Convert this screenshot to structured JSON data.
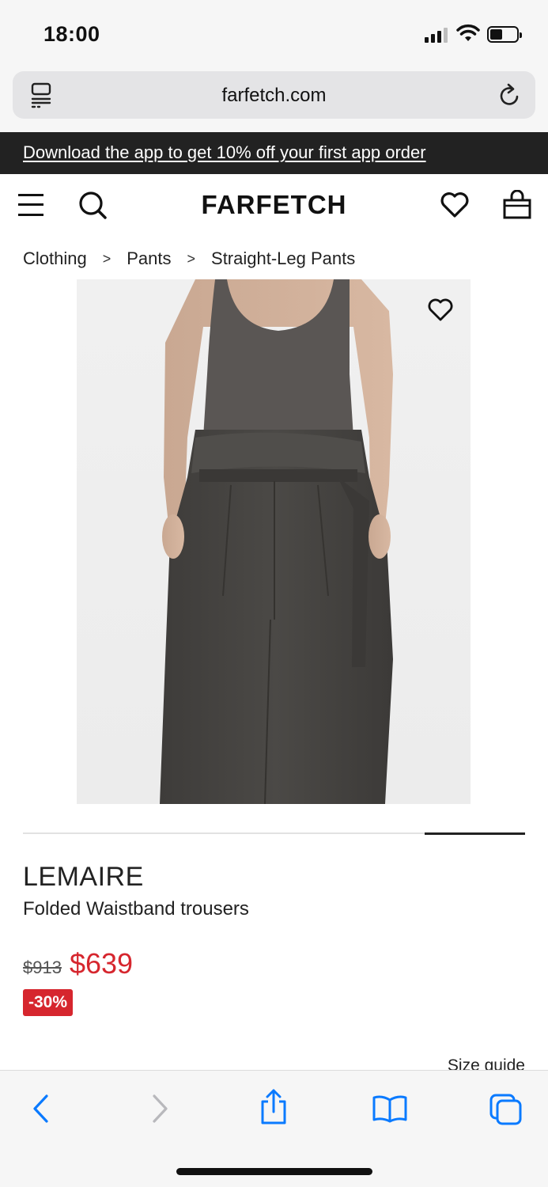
{
  "status_bar": {
    "time": "18:00"
  },
  "browser": {
    "url": "farfetch.com"
  },
  "promo": {
    "text": "Download the app to get 10% off your first app order"
  },
  "header": {
    "logo": "FARFETCH"
  },
  "breadcrumb": {
    "items": [
      "Clothing",
      "Pants",
      "Straight-Leg Pants"
    ],
    "separator": ">"
  },
  "product": {
    "brand": "LEMAIRE",
    "name": "Folded Waistband trousers",
    "original_price": "$913",
    "sale_price": "$639",
    "discount": "-30%",
    "size_guide": "Size guide",
    "image_description": "Model wearing dark grey ribbed tank top and belted folded waistband trousers"
  },
  "carousel": {
    "progress": 0.2
  },
  "colors": {
    "accent_red": "#d6262e",
    "promo_bg": "#222222",
    "ios_blue": "#0a7aff"
  },
  "icons": [
    "reader-icon",
    "reload-icon",
    "menu-icon",
    "search-icon",
    "heart-icon",
    "bag-icon",
    "wishlist-heart-icon",
    "back-icon",
    "forward-icon",
    "share-icon",
    "bookmarks-icon",
    "tabs-icon"
  ]
}
